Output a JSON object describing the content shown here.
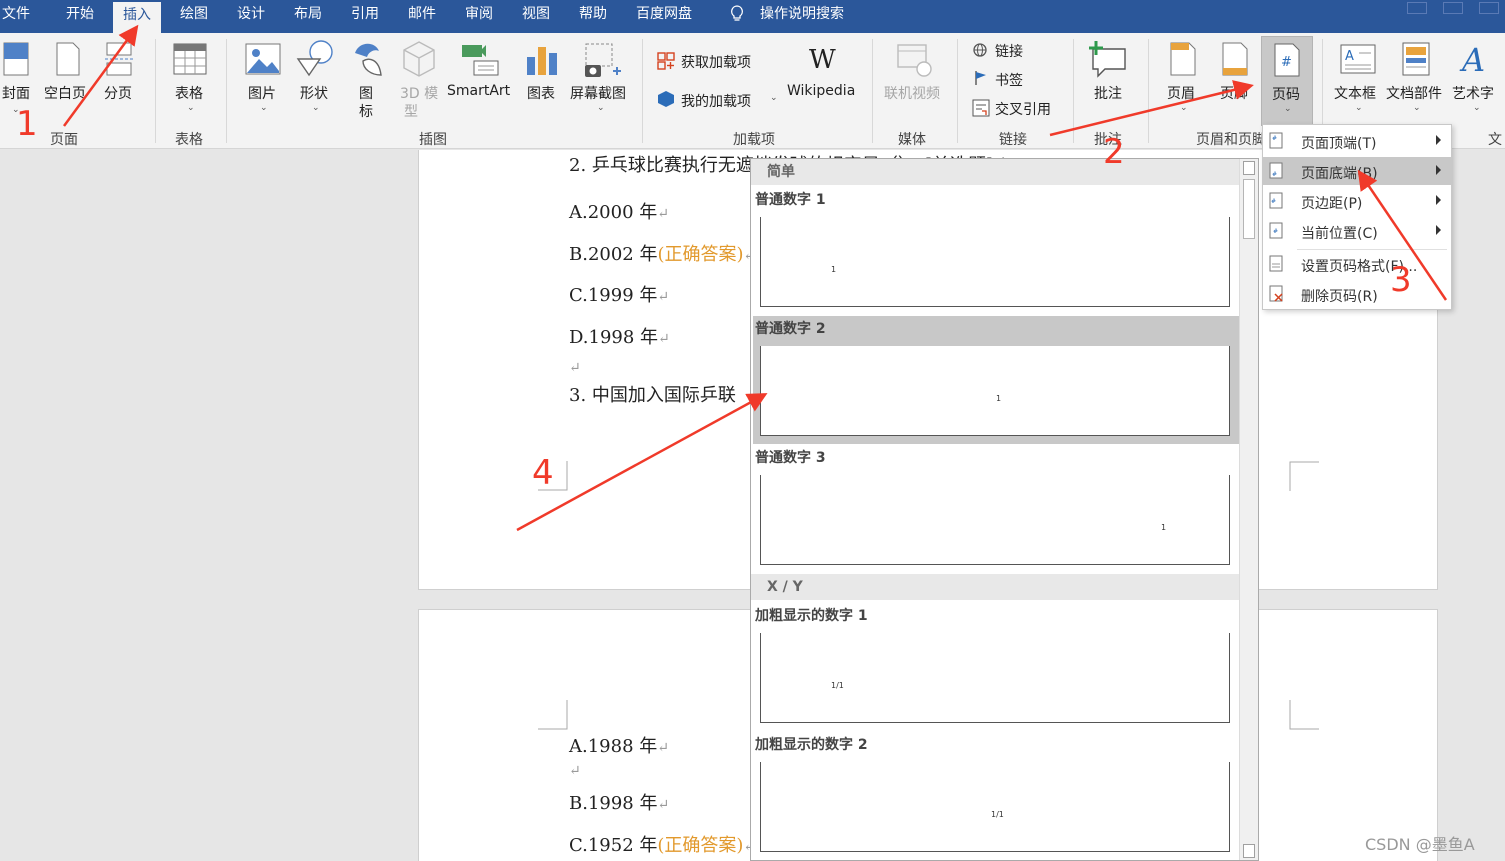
{
  "menu_tabs": [
    "文件",
    "开始",
    "插入",
    "绘图",
    "设计",
    "布局",
    "引用",
    "邮件",
    "审阅",
    "视图",
    "帮助",
    "百度网盘",
    "操作说明搜索"
  ],
  "ribbon": {
    "pages": {
      "cover": "封面",
      "blank": "空白页",
      "break": "分页",
      "group": "页面"
    },
    "table": {
      "label": "表格",
      "group": "表格"
    },
    "illustrations": {
      "picture": "图片",
      "shapes": "形状",
      "icons_1": "图",
      "icons_2": "标",
      "model_1": "3D 模",
      "model_2": "型",
      "smartart": "SmartArt",
      "chart": "图表",
      "screenshot": "屏幕截图",
      "group": "插图"
    },
    "addins": {
      "get": "获取加载项",
      "mine": "我的加载项",
      "wiki_logo": "W",
      "wiki": "Wikipedia",
      "group": "加载项"
    },
    "media": {
      "video": "联机视频",
      "group": "媒体"
    },
    "links": {
      "link": "链接",
      "bookmark": "书签",
      "crossref": "交叉引用",
      "group": "链接"
    },
    "comments": {
      "comment": "批注",
      "group": "批注"
    },
    "header_footer": {
      "header": "页眉",
      "footer": "页脚",
      "page_number": "页码",
      "group": "页眉和页脚"
    },
    "text": {
      "textbox": "文本框",
      "parts": "文档部件",
      "wordart": "艺术字",
      "group": "文"
    }
  },
  "submenu": [
    "页面顶端(T)",
    "页面底端(B)",
    "页边距(P)",
    "当前位置(C)",
    "设置页码格式(F)...",
    "删除页码(R)"
  ],
  "gallery": {
    "section1": "简单",
    "item1": "普通数字 1",
    "item2": "普通数字 2",
    "item3": "普通数字 3",
    "section2": "X / Y",
    "item4": "加粗显示的数字 1",
    "item5": "加粗显示的数字 2",
    "sample_simple": "1",
    "sample_xy": "1/1"
  },
  "document": {
    "q2": "2. 乒乓球比赛执行无遮挡发球的规定是（）。[单选题] *",
    "q2_a": "A.2000 年",
    "q2_b": "B.2002 年",
    "q2_b_ans": "(正确答案)",
    "q2_c": "C.1999 年",
    "q2_d": "D.1998 年",
    "q3": "3. 中国加入国际乒联",
    "q3_a": "A.1988 年",
    "q3_b": "B.1998 年",
    "q3_c": "C.1952 年",
    "q3_c_ans": "(正确答案)",
    "return_mark": "↵"
  },
  "annotations": [
    "1",
    "2",
    "3",
    "4"
  ],
  "watermark": "CSDN @墨鱼A",
  "colors": {
    "brand": "#2b579a",
    "annotation": "#f03a2a",
    "answer": "#e2992c"
  }
}
